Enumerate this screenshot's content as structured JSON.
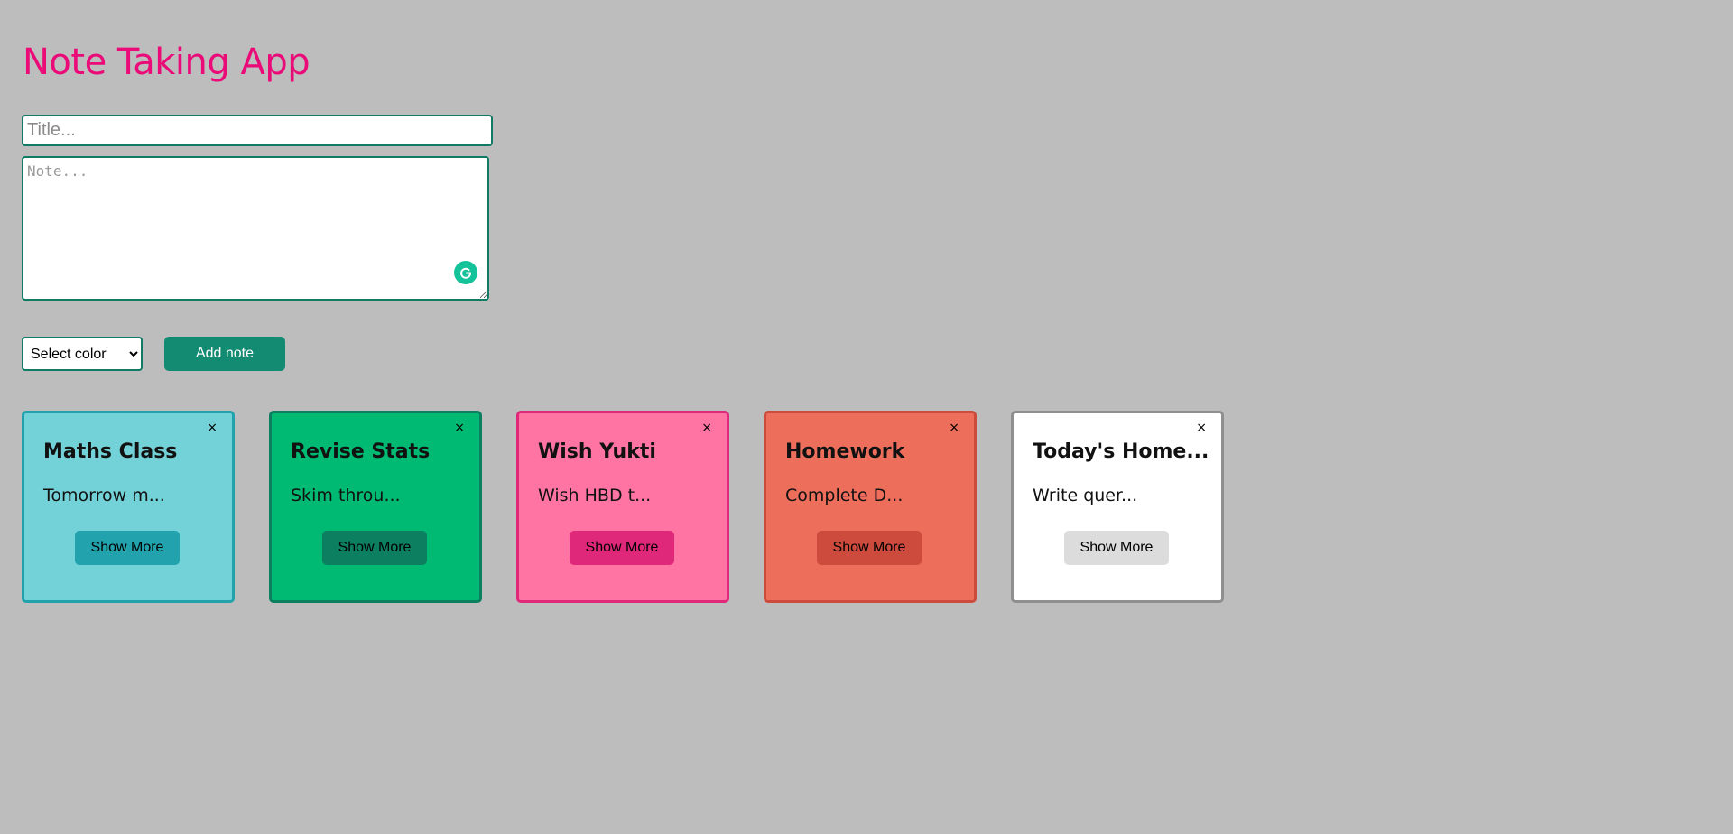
{
  "app": {
    "title": "Note Taking App",
    "title_color": "#ea0b78"
  },
  "form": {
    "title_placeholder": "Title...",
    "note_placeholder": "Note...",
    "color_select": {
      "selected": "Select color",
      "options": [
        "Select color"
      ]
    },
    "add_label": "Add note"
  },
  "notes": [
    {
      "title": "Maths Class",
      "text": "Tomorrow m...",
      "button": "Show More",
      "close": "×",
      "bg": "#72d2d7",
      "border": "#21a2ac",
      "button_bg": "#21a2ac"
    },
    {
      "title": "Revise Stats",
      "text": "Skim throu...",
      "button": "Show More",
      "close": "×",
      "bg": "#00b972",
      "border": "#0c7f61",
      "button_bg": "#0c7f61"
    },
    {
      "title": "Wish Yukti",
      "text": "Wish HBD t...",
      "button": "Show More",
      "close": "×",
      "bg": "#ff74a3",
      "border": "#e0287a",
      "button_bg": "#e0287a"
    },
    {
      "title": "Homework",
      "text": "Complete D...",
      "button": "Show More",
      "close": "×",
      "bg": "#ee6e5c",
      "border": "#cc4b3c",
      "button_bg": "#cc4b3c"
    },
    {
      "title": "Today's Home...",
      "text": "Write quer...",
      "button": "Show More",
      "close": "×",
      "bg": "#ffffff",
      "border": "#8f8f8f",
      "button_bg": "#dcdcdc"
    }
  ]
}
